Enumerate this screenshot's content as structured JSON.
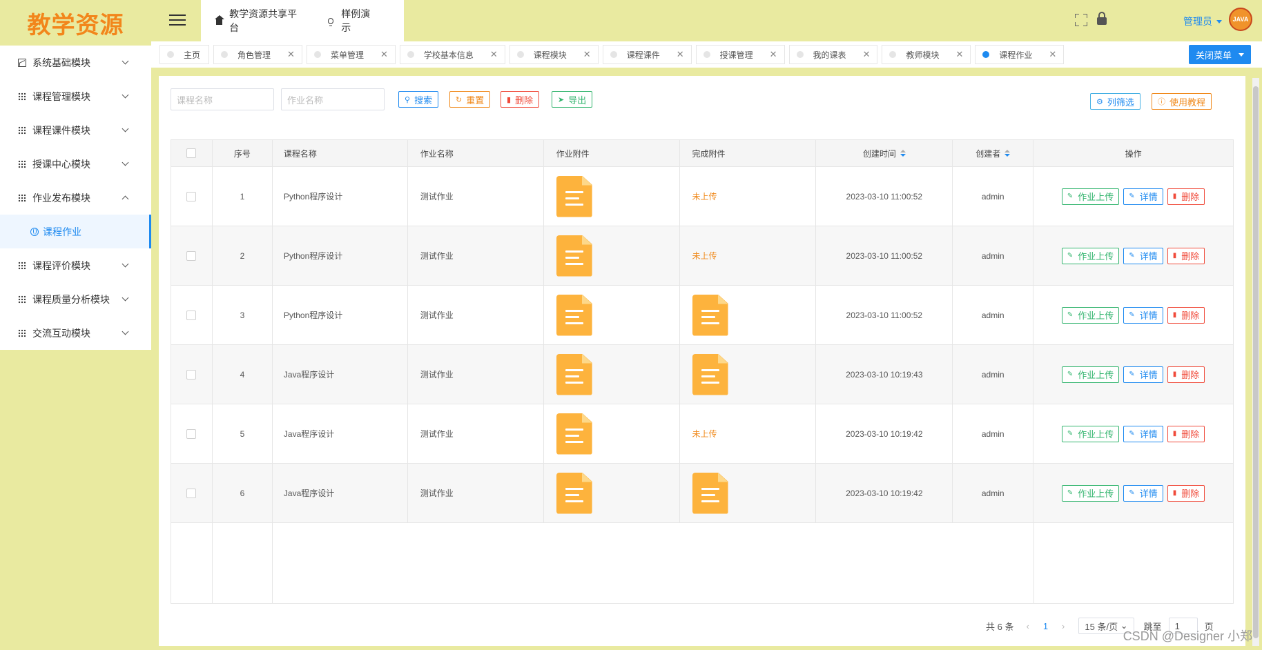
{
  "logo": "教学资源",
  "sidebar": {
    "items": [
      {
        "label": "系统基础模块"
      },
      {
        "label": "课程管理模块"
      },
      {
        "label": "课程课件模块"
      },
      {
        "label": "授课中心模块"
      },
      {
        "label": "作业发布模块"
      },
      {
        "label": "课程评价模块"
      },
      {
        "label": "课程质量分析模块"
      },
      {
        "label": "交流互动模块"
      }
    ],
    "active_sub": "课程作业"
  },
  "header": {
    "nav": [
      "教学资源共享平台",
      "样例演示"
    ],
    "user": "管理员",
    "avatar_text": "JAVA"
  },
  "tags": [
    {
      "label": "主页"
    },
    {
      "label": "角色管理"
    },
    {
      "label": "菜单管理"
    },
    {
      "label": "学校基本信息"
    },
    {
      "label": "课程模块"
    },
    {
      "label": "课程课件"
    },
    {
      "label": "授课管理"
    },
    {
      "label": "我的课表"
    },
    {
      "label": "教师模块"
    },
    {
      "label": "课程作业"
    }
  ],
  "close_menu": "关闭菜单",
  "filters": {
    "course_placeholder": "课程名称",
    "homework_placeholder": "作业名称"
  },
  "toolbar": {
    "search": "搜索",
    "reset": "重置",
    "delete": "删除",
    "export": "导出",
    "columns": "列筛选",
    "tutorial": "使用教程"
  },
  "table": {
    "headers": [
      "序号",
      "课程名称",
      "作业名称",
      "作业附件",
      "完成附件",
      "创建时间",
      "创建者",
      "操作"
    ],
    "rows": [
      {
        "no": "1",
        "course": "Python程序设计",
        "homework": "测试作业",
        "done_uploaded": false,
        "created": "2023-03-10 11:00:52",
        "creator": "admin"
      },
      {
        "no": "2",
        "course": "Python程序设计",
        "homework": "测试作业",
        "done_uploaded": false,
        "created": "2023-03-10 11:00:52",
        "creator": "admin"
      },
      {
        "no": "3",
        "course": "Python程序设计",
        "homework": "测试作业",
        "done_uploaded": true,
        "created": "2023-03-10 11:00:52",
        "creator": "admin"
      },
      {
        "no": "4",
        "course": "Java程序设计",
        "homework": "测试作业",
        "done_uploaded": true,
        "created": "2023-03-10 10:19:43",
        "creator": "admin"
      },
      {
        "no": "5",
        "course": "Java程序设计",
        "homework": "测试作业",
        "done_uploaded": false,
        "created": "2023-03-10 10:19:42",
        "creator": "admin"
      },
      {
        "no": "6",
        "course": "Java程序设计",
        "homework": "测试作业",
        "done_uploaded": true,
        "created": "2023-03-10 10:19:42",
        "creator": "admin"
      }
    ],
    "not_uploaded": "未上传",
    "actions": {
      "upload": "作业上传",
      "detail": "详情",
      "delete": "删除"
    }
  },
  "pagination": {
    "total": "共 6 条",
    "page": "1",
    "page_size": "15 条/页",
    "goto_label": "跳至",
    "goto_value": "1",
    "page_suffix": "页"
  },
  "watermark": "CSDN @Designer 小郑",
  "colors": {
    "accent": "#1e8af0",
    "bg": "#e9eaa0",
    "file": "#fdb33d"
  }
}
